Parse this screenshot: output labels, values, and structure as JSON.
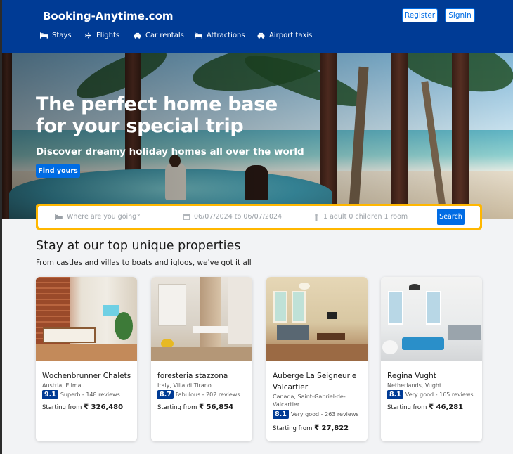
{
  "header": {
    "brand": "Booking-Anytime.com",
    "register": "Register",
    "signin": "Signin",
    "nav": [
      {
        "label": "Stays",
        "icon": "bed-icon"
      },
      {
        "label": "Flights",
        "icon": "plane-icon"
      },
      {
        "label": "Car rentals",
        "icon": "car-icon"
      },
      {
        "label": "Attractions",
        "icon": "bed-icon"
      },
      {
        "label": "Airport taxis",
        "icon": "car-icon"
      }
    ]
  },
  "hero": {
    "title_line1": "The perfect home base",
    "title_line2": "for your special trip",
    "subtitle": "Discover dreamy holiday homes all over the world",
    "cta": "Find yours"
  },
  "search": {
    "destination_placeholder": "Where are you going?",
    "dates": "06/07/2024 to 06/07/2024",
    "guests": "1 adult 0 children 1 room",
    "button": "Search"
  },
  "section": {
    "title": "Stay at our top unique properties",
    "subtitle": "From castles and villas to boats and igloos, we've got it all"
  },
  "properties": [
    {
      "name": "Wochenbrunner Chalets",
      "location": "Austria, Ellmau",
      "score": "9.1",
      "rating_text": "Superb - 148 reviews",
      "price_label": "Starting from",
      "price": "₹ 326,480"
    },
    {
      "name": "foresteria stazzona",
      "location": "Italy, Villa di Tirano",
      "score": "8.7",
      "rating_text": "Fabulous - 202 reviews",
      "price_label": "Starting from",
      "price": "₹ 56,854"
    },
    {
      "name": "Auberge La Seigneurie Valcartier",
      "location": "Canada, Saint-Gabriel-de-Valcartier",
      "score": "8.1",
      "rating_text": "Very good - 263 reviews",
      "price_label": "Starting from",
      "price": "₹ 27,822"
    },
    {
      "name": "Regina Vught",
      "location": "Netherlands, Vught",
      "score": "8.1",
      "rating_text": "Very good - 165 reviews",
      "price_label": "Starting from",
      "price": "₹ 46,281"
    }
  ],
  "colors": {
    "primary": "#003b95",
    "accent": "#006ce4",
    "search_border": "#ffb700"
  }
}
